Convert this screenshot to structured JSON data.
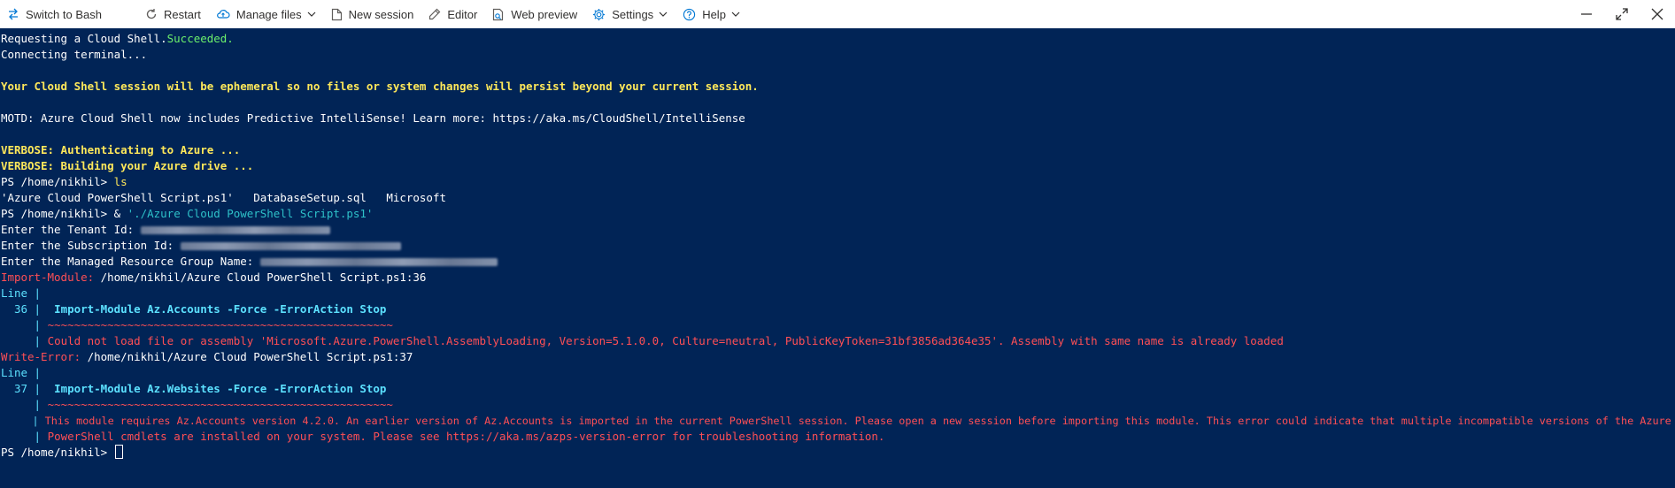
{
  "toolbar": {
    "switch_bash": "Switch to Bash",
    "restart": "Restart",
    "manage_files": "Manage files",
    "new_session": "New session",
    "editor": "Editor",
    "web_preview": "Web preview",
    "settings": "Settings",
    "help": "Help"
  },
  "terminal": {
    "l01_a": "Requesting a Cloud Shell.",
    "l01_b": "Succeeded.",
    "l02": "Connecting terminal...",
    "l04": "Your Cloud Shell session will be ephemeral so no files or system changes will persist beyond your current session.",
    "l06": "MOTD: Azure Cloud Shell now includes Predictive IntelliSense! Learn more: https://aka.ms/CloudShell/IntelliSense",
    "l08": "VERBOSE: Authenticating to Azure ...",
    "l09": "VERBOSE: Building your Azure drive ...",
    "prompt": "PS /home/nikhil> ",
    "cmd_ls": "ls",
    "ls_output": "'Azure Cloud PowerShell Script.ps1'   DatabaseSetup.sql   Microsoft",
    "amp": "& ",
    "script_path": "'./Azure Cloud PowerShell Script.ps1'",
    "tenant_label": "Enter the Tenant Id: ",
    "subscription_label": "Enter the Subscription Id: ",
    "mrg_label": "Enter the Managed Resource Group Name: ",
    "err1_label": "Import-Module: ",
    "err1_loc": "/home/nikhil/Azure Cloud PowerShell Script.ps1:36",
    "line_word": "Line |",
    "err1_num": "  36 | ",
    "err1_code": " Import-Module Az.Accounts -Force -ErrorAction Stop",
    "bar": "     | ",
    "err1_squig": "~~~~~~~~~~~~~~~~~~~~~~~~~~~~~~~~~~~~~~~~~~~~~~~~~~~~",
    "err1_msg": "Could not load file or assembly 'Microsoft.Azure.PowerShell.AssemblyLoading, Version=5.1.0.0, Culture=neutral, PublicKeyToken=31bf3856ad364e35'. Assembly with same name is already loaded",
    "err2_label": "Write-Error: ",
    "err2_loc": "/home/nikhil/Azure Cloud PowerShell Script.ps1:37",
    "err2_num": "  37 | ",
    "err2_code": " Import-Module Az.Websites -Force -ErrorAction Stop",
    "err2_squig": "~~~~~~~~~~~~~~~~~~~~~~~~~~~~~~~~~~~~~~~~~~~~~~~~~~~~",
    "err2_msg1": "This module requires Az.Accounts version 4.2.0. An earlier version of Az.Accounts is imported in the current PowerShell session. Please open a new session before importing this module. This error could indicate that multiple incompatible versions of the Azure",
    "err2_msg2": "PowerShell cmdlets are installed on your system. Please see https://aka.ms/azps-version-error for troubleshooting information."
  },
  "colors": {
    "background": "#012456",
    "success": "#6cf06c",
    "warning": "#ffe85a",
    "error": "#ff4f55",
    "accent": "#5ce1ff"
  },
  "icons": [
    "switch-icon",
    "restart-icon",
    "manage-files-icon",
    "chevron-down-icon",
    "new-session-icon",
    "editor-icon",
    "web-preview-icon",
    "settings-icon",
    "help-icon",
    "minimize-icon",
    "maximize-icon",
    "close-icon"
  ]
}
